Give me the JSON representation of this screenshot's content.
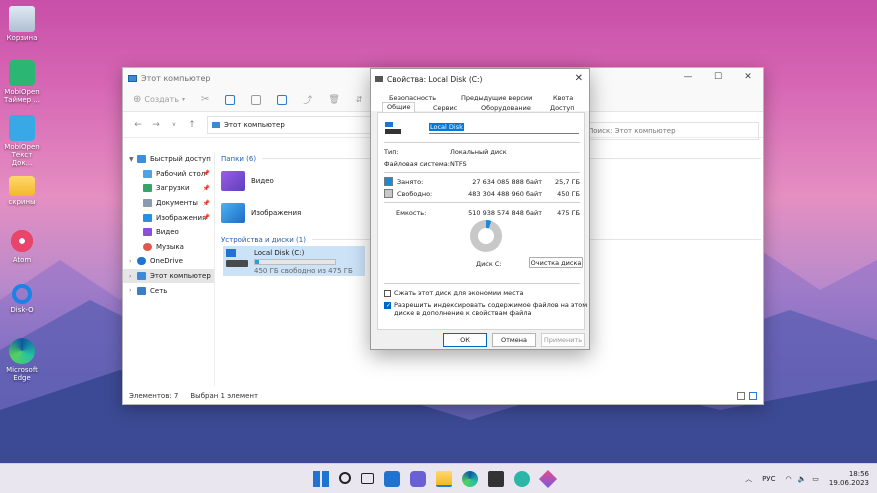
{
  "desktop": {
    "icons": [
      {
        "label": "Корзина"
      },
      {
        "label": "MobiOpen Таймер ..."
      },
      {
        "label": "MobiOpen Текст Док..."
      },
      {
        "label": "скрины"
      },
      {
        "label": "Atom"
      },
      {
        "label": "Disk-O"
      },
      {
        "label": "Microsoft Edge"
      }
    ]
  },
  "explorer": {
    "title": "Этот компьютер",
    "toolbar": {
      "create_label": "Создать"
    },
    "address": "Этот компьютер",
    "search_placeholder": "Поиск: Этот компьютер",
    "nav": {
      "quick_access": "Быстрый доступ",
      "desktop": "Рабочий стол",
      "downloads": "Загрузки",
      "documents": "Документы",
      "pictures": "Изображения",
      "videos": "Видео",
      "music": "Музыка",
      "onedrive": "OneDrive",
      "this_pc": "Этот компьютер",
      "network": "Сеть"
    },
    "folders_header": "Папки (6)",
    "folders": [
      {
        "label": "Видео"
      },
      {
        "label": "Изображения"
      }
    ],
    "devices_header": "Устройства и диски (1)",
    "drive": {
      "name": "Local Disk (C:)",
      "free_text": "450 ГБ свободно из 475 ГБ",
      "used_fraction": 0.054
    },
    "status": {
      "items": "Элементов: 7",
      "selected": "Выбран 1 элемент"
    }
  },
  "dialog": {
    "title": "Свойства: Local Disk (C:)",
    "tabs_row1": [
      "Безопасность",
      "Предыдущие версии",
      "Квота"
    ],
    "tabs_row2": [
      "Общие",
      "Сервис",
      "Оборудование",
      "Доступ"
    ],
    "volume_label": "Local Disk",
    "type_label": "Тип:",
    "type_value": "Локальный диск",
    "fs_label": "Файловая система:",
    "fs_value": "NTFS",
    "used_label": "Занято:",
    "used_bytes": "27 634 085 888 байт",
    "used_gb": "25,7 ГБ",
    "free_label": "Свободно:",
    "free_bytes": "483 304 488 960 байт",
    "free_gb": "450 ГБ",
    "capacity_label": "Емкость:",
    "capacity_bytes": "510 938 574 848 байт",
    "capacity_gb": "475 ГБ",
    "disk_caption": "Диск C:",
    "cleanup_button": "Очистка диска",
    "compress_label": "Сжать этот диск для экономии места",
    "index_label_1": "Разрешить индексировать содержимое файлов на этом",
    "index_label_2": "диске в дополнение к свойствам файла",
    "ok_button": "ОК",
    "cancel_button": "Отмена",
    "apply_button": "Применить",
    "colors": {
      "used": "#1a8ad8",
      "free": "#c8c8c8"
    }
  },
  "taskbar": {
    "lang": "РУС",
    "time": "18:56",
    "date": "19.06.2023"
  }
}
